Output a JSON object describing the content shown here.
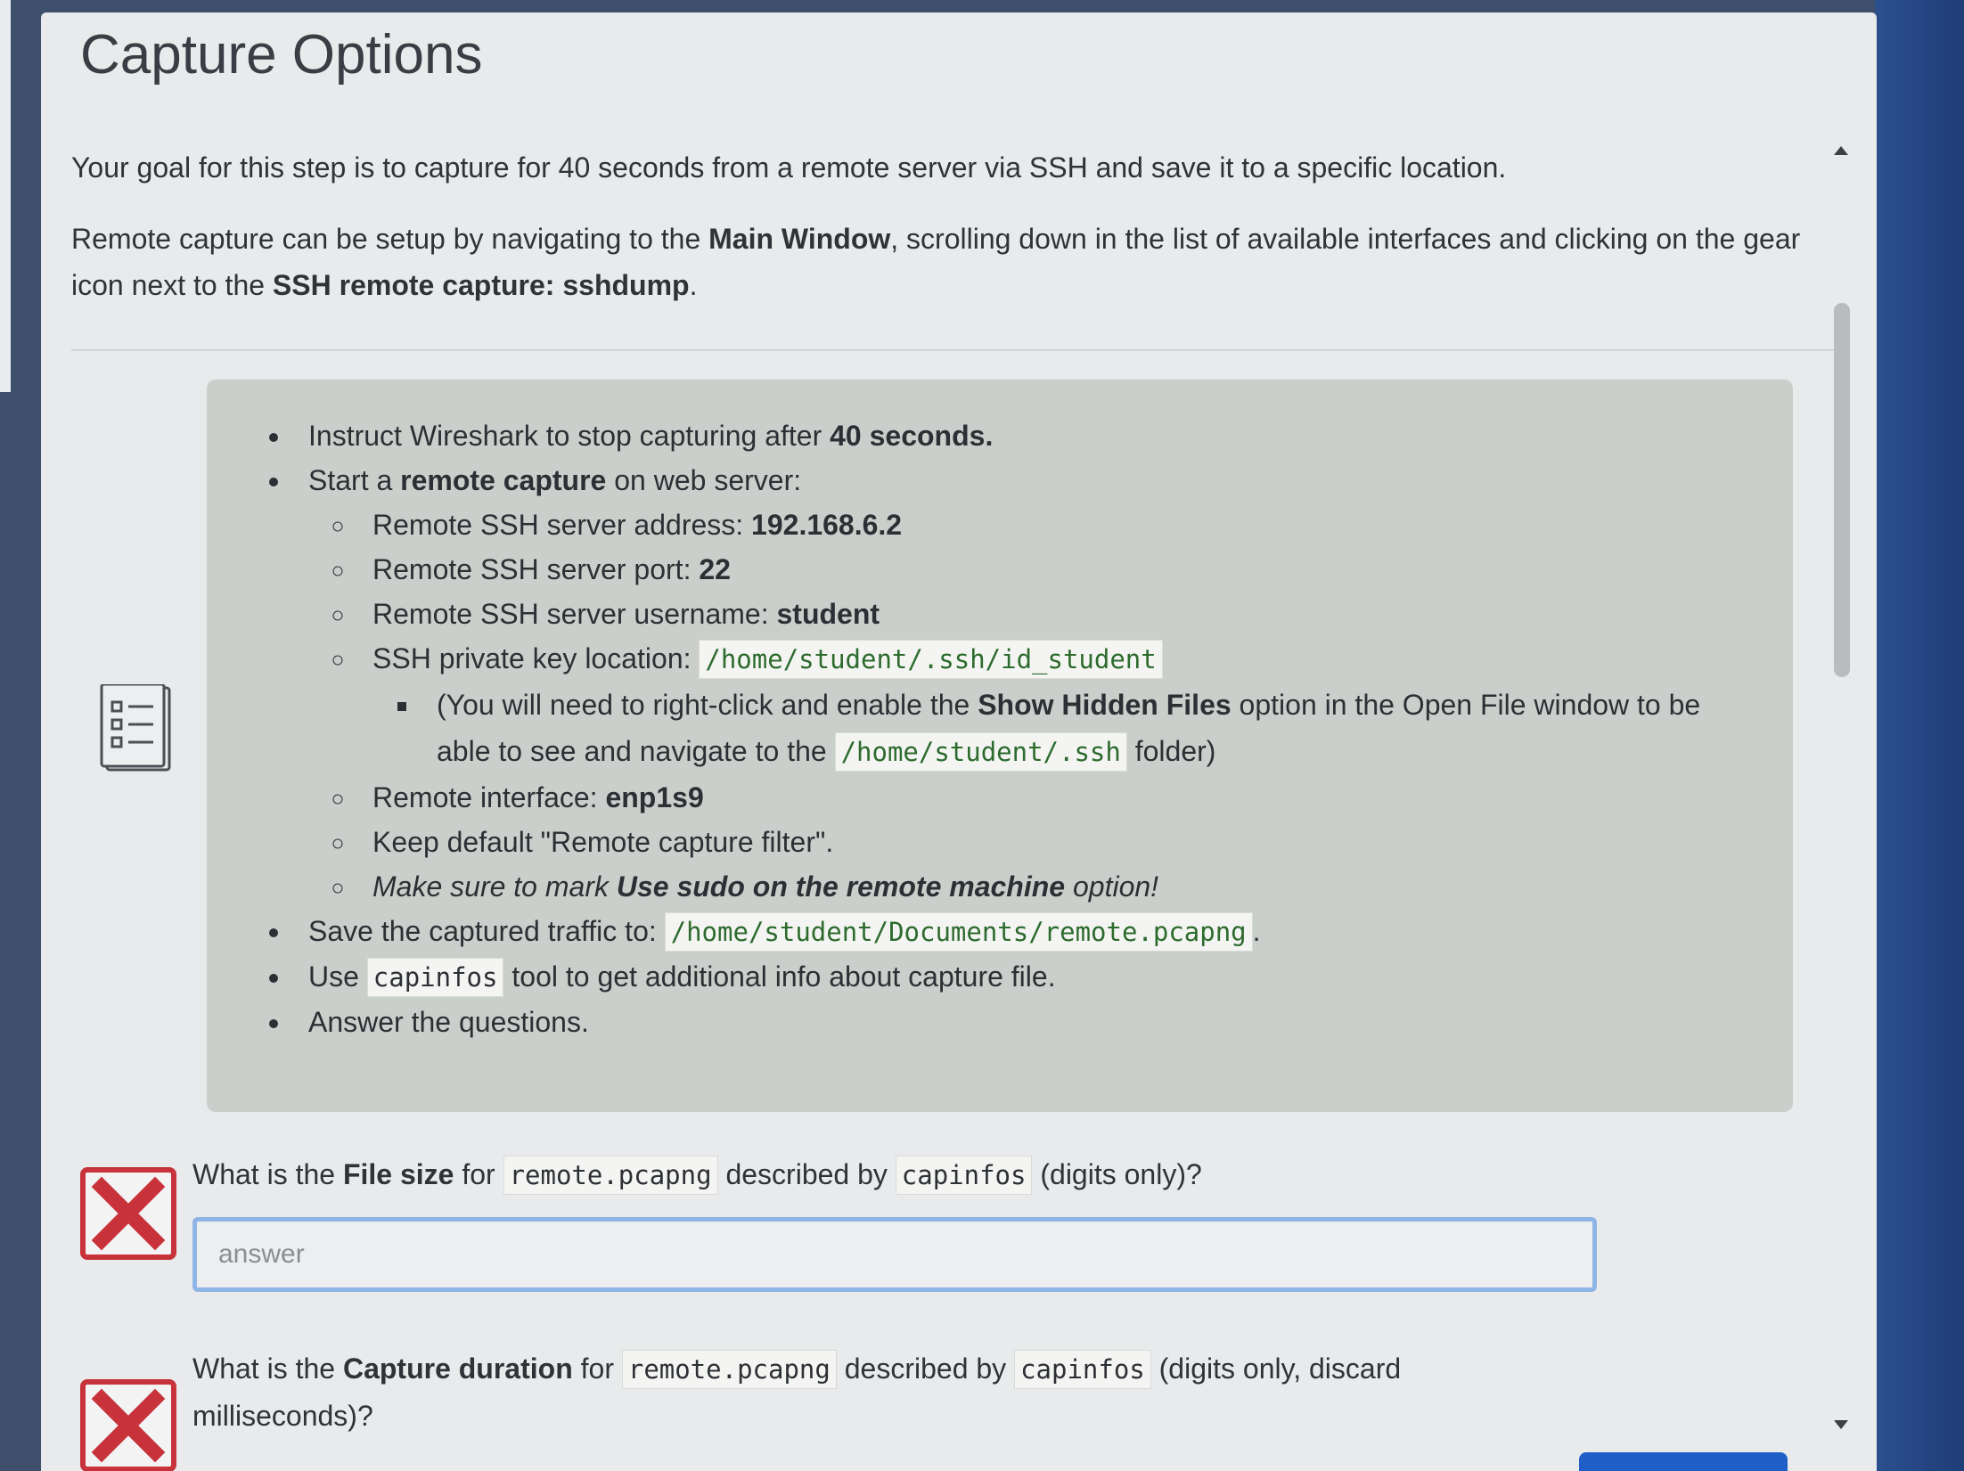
{
  "title": "Capture Options",
  "intro": {
    "p1": "Your goal for this step is to capture for 40 seconds from a remote server via SSH and save it to a specific location.",
    "p2_a": "Remote capture can be setup by navigating to the ",
    "p2_b": "Main Window",
    "p2_c": ", scrolling down in the list of available interfaces and clicking on the gear icon next to the ",
    "p2_d": "SSH remote capture: sshdump",
    "p2_e": "."
  },
  "tasks": {
    "t1_a": "Instruct Wireshark to stop capturing after ",
    "t1_b": "40 seconds.",
    "t2_a": "Start a ",
    "t2_b": "remote capture",
    "t2_c": " on web server:",
    "addr_a": "Remote SSH server address: ",
    "addr_b": "192.168.6.2",
    "port_a": "Remote SSH server port: ",
    "port_b": "22",
    "user_a": "Remote SSH server username: ",
    "user_b": "student",
    "key_a": "SSH private key location: ",
    "key_b": "/home/student/.ssh/id_student",
    "hidden_a": "(You will need to right-click and enable the ",
    "hidden_b": "Show Hidden Files",
    "hidden_c": " option in the Open File window to be able to see and navigate to the ",
    "hidden_d": "/home/student/.ssh",
    "hidden_e": " folder)",
    "iface_a": "Remote interface: ",
    "iface_b": "enp1s9",
    "filter": "Keep default \"Remote capture filter\".",
    "sudo_a": "Make sure to mark ",
    "sudo_b": "Use sudo on the remote machine",
    "sudo_c": " option!",
    "save_a": "Save the captured traffic to: ",
    "save_b": "/home/student/Documents/remote.pcapng",
    "save_c": ".",
    "use_a": "Use ",
    "use_b": "capinfos",
    "use_c": " tool to get additional info about capture file.",
    "answer": "Answer the questions."
  },
  "q1": {
    "a": "What is the ",
    "b": "File size",
    "c": " for ",
    "d": "remote.pcapng",
    "e": " described by ",
    "f": "capinfos",
    "g": " (digits only)?",
    "placeholder": "answer"
  },
  "q2": {
    "a": "What is the ",
    "b": "Capture duration",
    "c": " for ",
    "d": "remote.pcapng",
    "e": " described by ",
    "f": "capinfos",
    "g": " (digits only, discard milliseconds)?"
  },
  "colors": {
    "error_red": "#c8323a",
    "input_border": "#8fb4e6",
    "code_green": "#2d6b2d",
    "primary_blue": "#1f5fc7"
  },
  "icons": [
    "checklist-icon",
    "incorrect-x-icon",
    "scroll-up-icon",
    "scroll-down-icon"
  ]
}
